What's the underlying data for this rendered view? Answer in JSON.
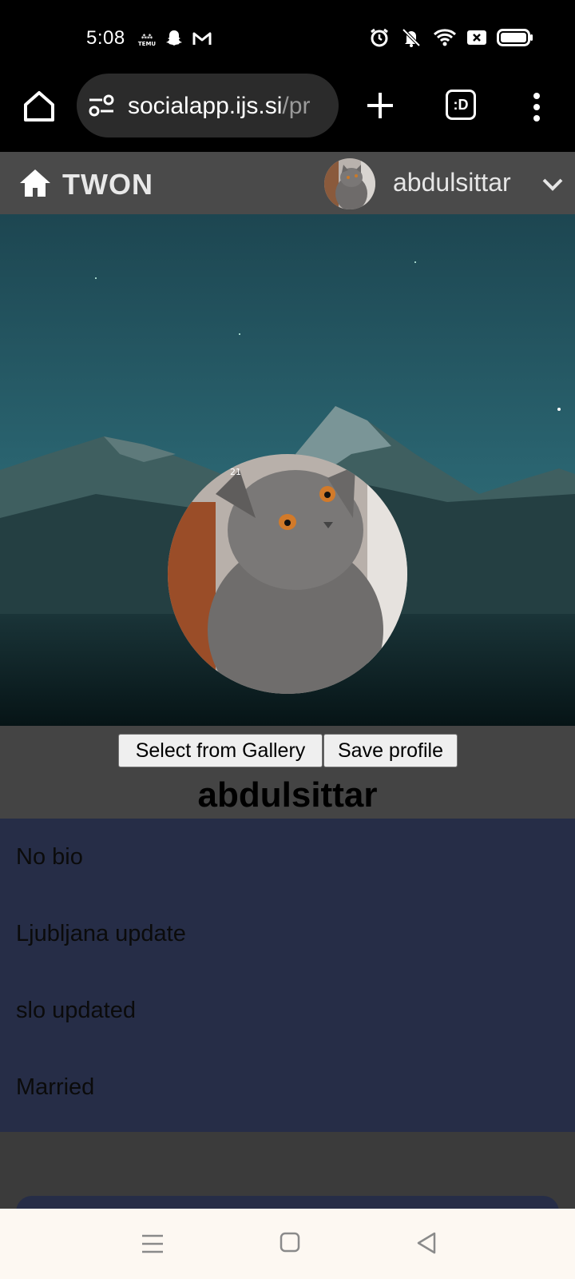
{
  "status_bar": {
    "time": "5:08",
    "left_icons": [
      "temu-icon",
      "snapchat-icon",
      "gmail-icon"
    ],
    "right_icons": [
      "alarm-icon",
      "mute-icon",
      "wifi-icon",
      "sim-off-icon",
      "battery-icon"
    ],
    "temu_label": "TEMU"
  },
  "browser": {
    "url_main": "socialapp.ijs.si",
    "url_rest": "/pr",
    "tabs_label": ":D"
  },
  "header": {
    "brand": "TWON",
    "username": "abdulsittar"
  },
  "profile": {
    "gallery_button": "Select from Gallery",
    "save_button": "Save profile",
    "name": "abdulsittar",
    "photo_tag": "21"
  },
  "info": {
    "items": [
      "No bio",
      "Ljubljana update",
      "slo updated",
      "Married"
    ]
  },
  "colors": {
    "header_bg": "#4a4a4a",
    "info_bg": "#262d47",
    "page_bg": "#3b3b3b",
    "nav_bg": "#fdf8f2"
  }
}
